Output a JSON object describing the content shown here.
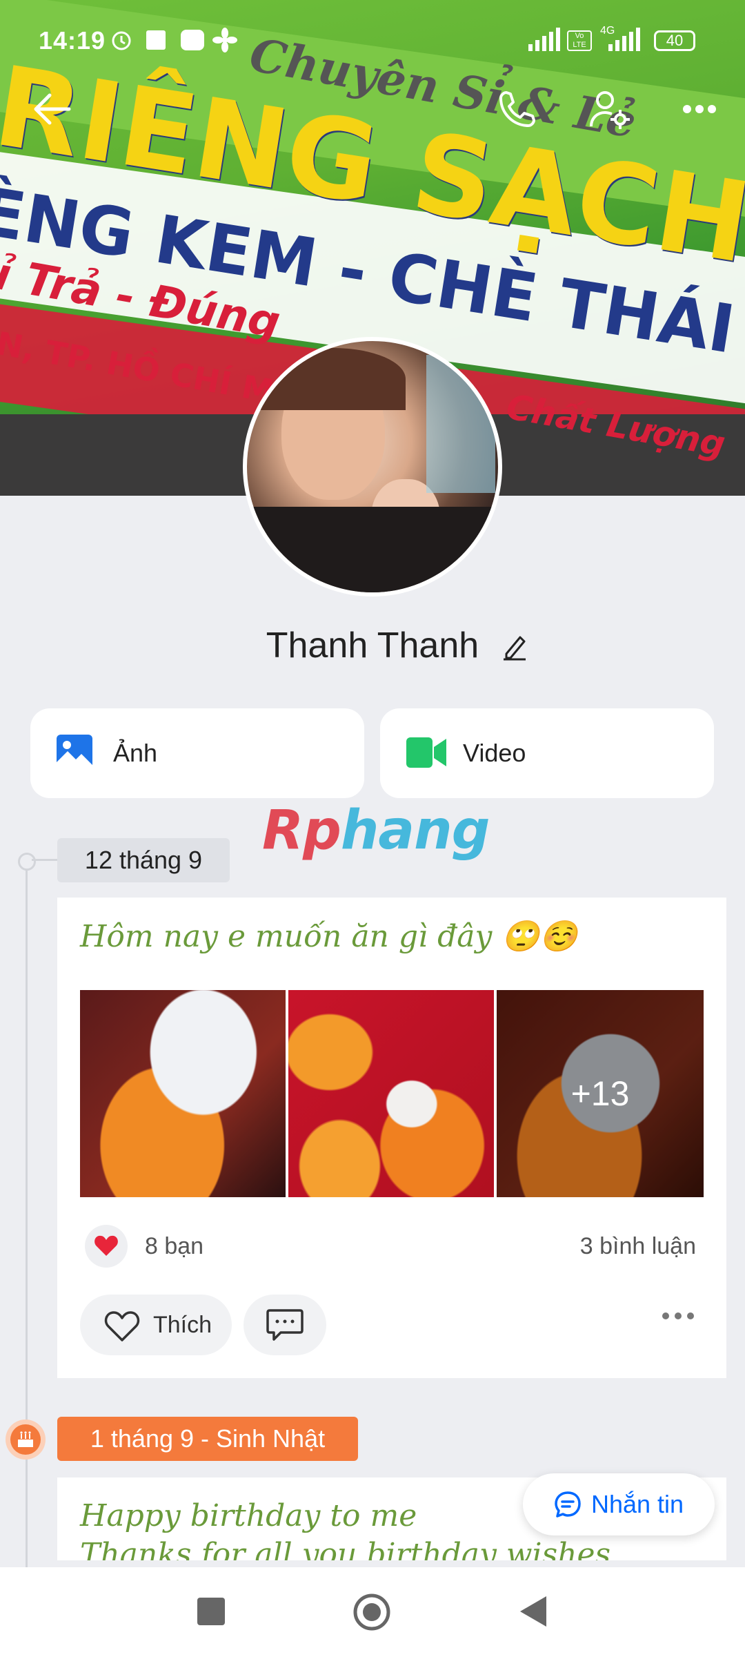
{
  "status": {
    "time": "14:19",
    "battery": "40",
    "network": "4G"
  },
  "cover": {
    "lines": [
      "Chuyên Sỉ & Lẻ",
      "RIÊNG SẠCH",
      "ÈNG KEM - CHÈ THÁI - SINH",
      "ỉ Trả - Đúng",
      "N, TP. HỒ CHÍ MIN",
      "Chất Lượng"
    ]
  },
  "header": {
    "back_icon": "back-arrow-icon",
    "call_icon": "phone-icon",
    "settings_icon": "user-settings-icon",
    "more_icon": "more-icon"
  },
  "profile": {
    "name": "Thanh Thanh"
  },
  "tiles": {
    "photo_label": "Ảnh",
    "video_label": "Video"
  },
  "watermark": {
    "part1": "Rp",
    "part2": "hang"
  },
  "posts": [
    {
      "date": "12 tháng 9",
      "text": "Hôm nay e muốn ăn gì đây 🙄☺️",
      "more_photos": "+13",
      "reactions": "8 bạn",
      "comments": "3 bình luận",
      "like_label": "Thích"
    },
    {
      "date": "1 tháng 9 - Sinh Nhật",
      "line1": "Happy birthday to me",
      "line2": "Thanks for all you birthday wishes"
    }
  ],
  "message_button": {
    "label": "Nhắn tin"
  },
  "colors": {
    "accent": "#0068ff",
    "birthday": "#f47a3c",
    "post_text": "#6a9a3a"
  }
}
